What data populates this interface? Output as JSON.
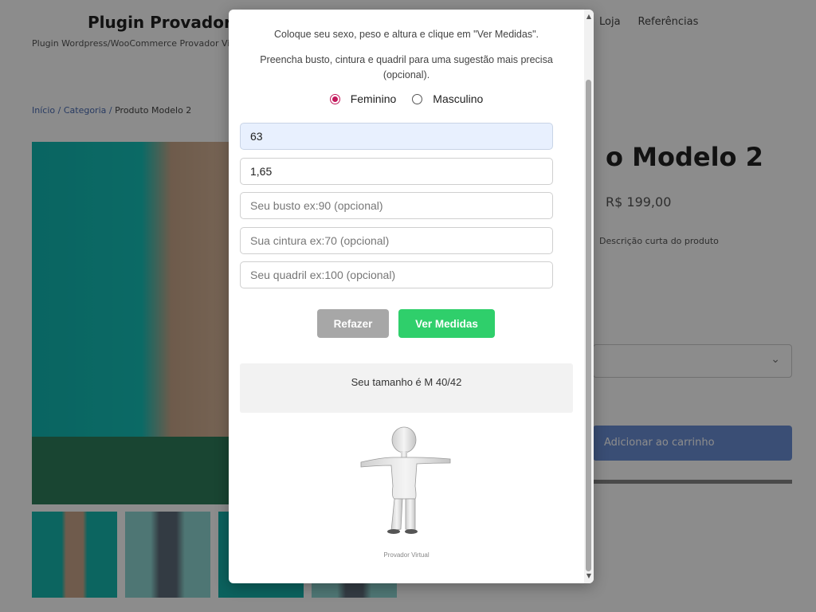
{
  "background": {
    "site_title": "Plugin Provador V",
    "site_tagline": "Plugin Wordpress/WooCommerce Provador Virtual para lojas",
    "nav": [
      "Loja",
      "Referências"
    ],
    "breadcrumb": {
      "home": "Início",
      "sep": "/",
      "category": "Categoria",
      "current": "Produto Modelo 2"
    },
    "product_title": "o Modelo 2",
    "price": "R$ 199,00",
    "meta": "Descrição curta do produto",
    "select_arrow": "⌄",
    "cart_label": "Adicionar ao carrinho"
  },
  "modal": {
    "instruction_1": "Coloque seu sexo, peso e altura e clique em \"Ver Medidas\".",
    "instruction_2": "Preencha busto, cintura e quadril para uma sugestão mais precisa (opcional).",
    "gender": {
      "options": [
        "Feminino",
        "Masculino"
      ],
      "selected": "Feminino"
    },
    "fields": {
      "weight": {
        "value": "63",
        "placeholder": ""
      },
      "height": {
        "value": "1,65",
        "placeholder": ""
      },
      "bust": {
        "value": "",
        "placeholder": "Seu busto ex:90 (opcional)"
      },
      "waist": {
        "value": "",
        "placeholder": "Sua cintura ex:70 (opcional)"
      },
      "hip": {
        "value": "",
        "placeholder": "Seu quadril ex:100 (opcional)"
      }
    },
    "buttons": {
      "redo": "Refazer",
      "measure": "Ver Medidas"
    },
    "result": "Seu tamanho é M 40/42",
    "caption": "Provador Virtual",
    "scroll_up": "▲",
    "scroll_down": "▼"
  },
  "colors": {
    "accent_green": "#2fcf6b",
    "radio_selected": "#c2185b",
    "redo_gray": "#a7a7a7"
  }
}
